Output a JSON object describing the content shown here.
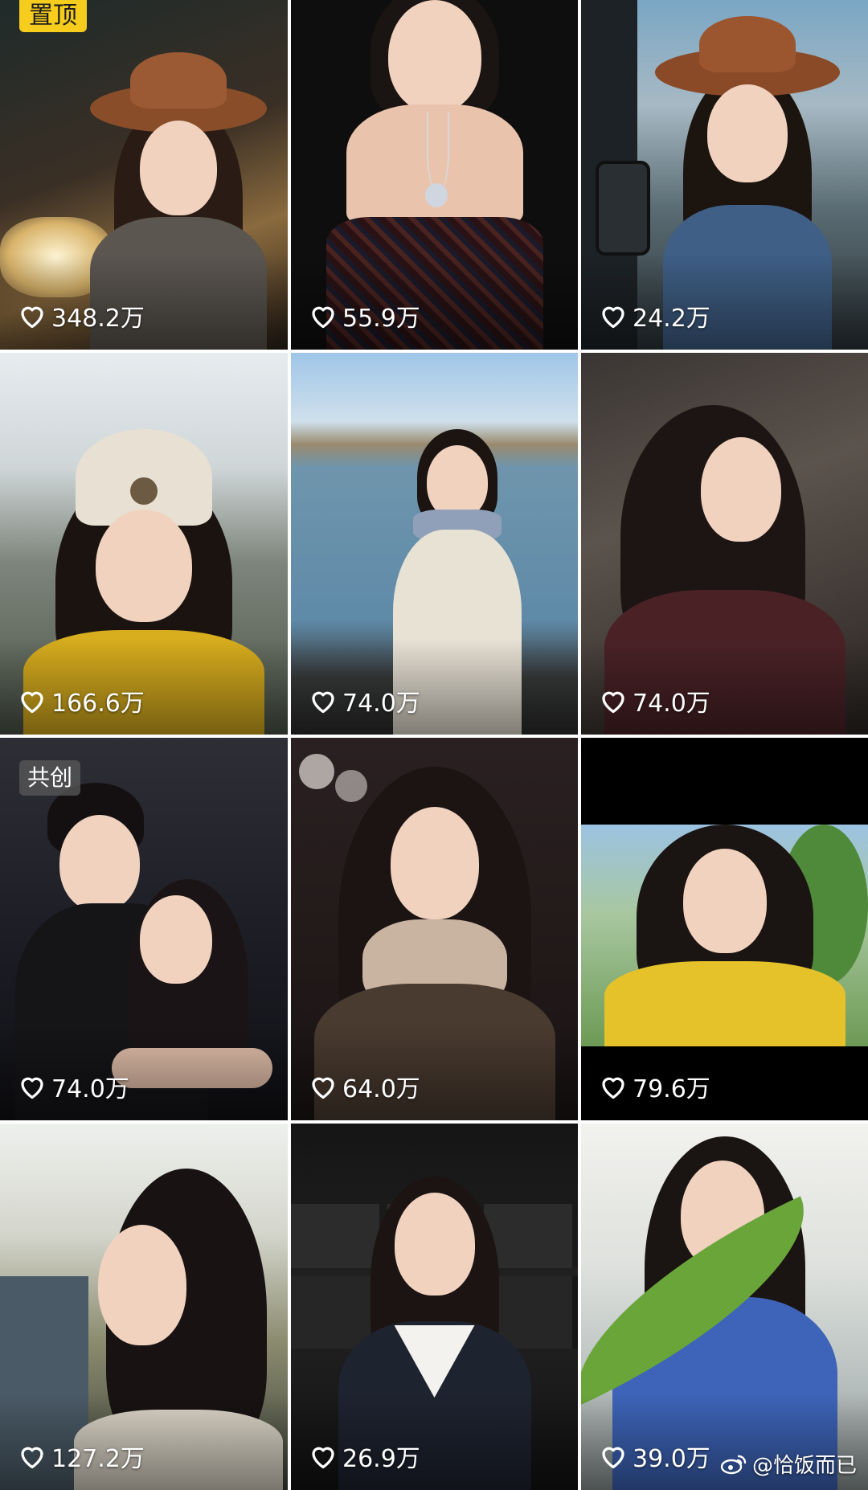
{
  "badges": {
    "pinned": "置顶",
    "collab": "共创"
  },
  "tiles": [
    {
      "likes": "348.2万"
    },
    {
      "likes": "55.9万"
    },
    {
      "likes": "24.2万"
    },
    {
      "likes": "166.6万"
    },
    {
      "likes": "74.0万"
    },
    {
      "likes": "74.0万"
    },
    {
      "likes": "74.0万"
    },
    {
      "likes": "64.0万"
    },
    {
      "likes": "79.6万"
    },
    {
      "likes": "127.2万"
    },
    {
      "likes": "26.9万"
    },
    {
      "likes": "39.0万"
    }
  ],
  "watermark": {
    "text": "@恰饭而已",
    "icon": "weibo-logo-icon"
  },
  "icons": {
    "like": "heart-outline-icon"
  },
  "colors": {
    "pinned_badge": "#f6cd1c",
    "like_text": "#ffffff"
  }
}
